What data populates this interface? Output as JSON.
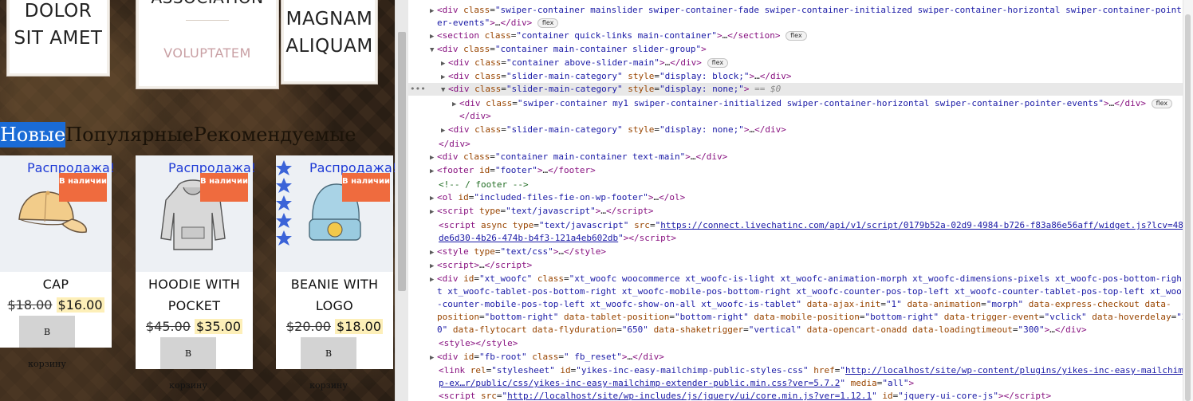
{
  "quick_links": [
    {
      "line1": "DOLOR",
      "line2": "SIT AMET"
    },
    {
      "line1": "ASSOCIATION",
      "line2": "VOLUPTATEM"
    },
    {
      "line1": "MAGNAM",
      "line2": "ALIQUAM"
    }
  ],
  "tabs": [
    "Новые",
    "Популярные",
    "Рекомендуемые"
  ],
  "colors": {
    "sale_text": "#1f3bd6",
    "stock_badge": "#ef6b3e",
    "price_highlight": "#fdefb8",
    "active_tab": "#1a6bd6"
  },
  "products": [
    {
      "sale": "Распродажа!",
      "stock": "В наличии",
      "title": "CAP",
      "old_price": "$18.00",
      "new_price": "$16.00",
      "button": "В корзину",
      "icon": "cap-image"
    },
    {
      "sale": "Распродажа!",
      "stock": "В наличии",
      "title": "HOODIE WITH POCKET",
      "old_price": "$45.00",
      "new_price": "$35.00",
      "button": "В корзину",
      "icon": "hoodie-image"
    },
    {
      "sale": "Распродажа!",
      "stock": "В наличии",
      "title": "BEANIE WITH LOGO",
      "old_price": "$20.00",
      "new_price": "$18.00",
      "button": "В корзину",
      "icon": "beanie-image"
    }
  ],
  "devtools": {
    "eq0": "== $0",
    "script_url": "https://connect.livechatinc.com/api/v1/script/0179b52a-02d9-4984-b726-f83a86e56aff/widget.js?lcv=48de6d30-4b26-474b-b4f3-121a4eb602db",
    "stylesheet_url": "http://localhost/site/wp-content/plugins/yikes-inc-easy-mailchimp-ex…r/public/css/yikes-inc-easy-mailchimp-extender-public.min.css?ver=5.7.2",
    "jquery_url": "http://localhost/site/wp-includes/js/jquery/ui/core.min.js?ver=1.12.1"
  }
}
